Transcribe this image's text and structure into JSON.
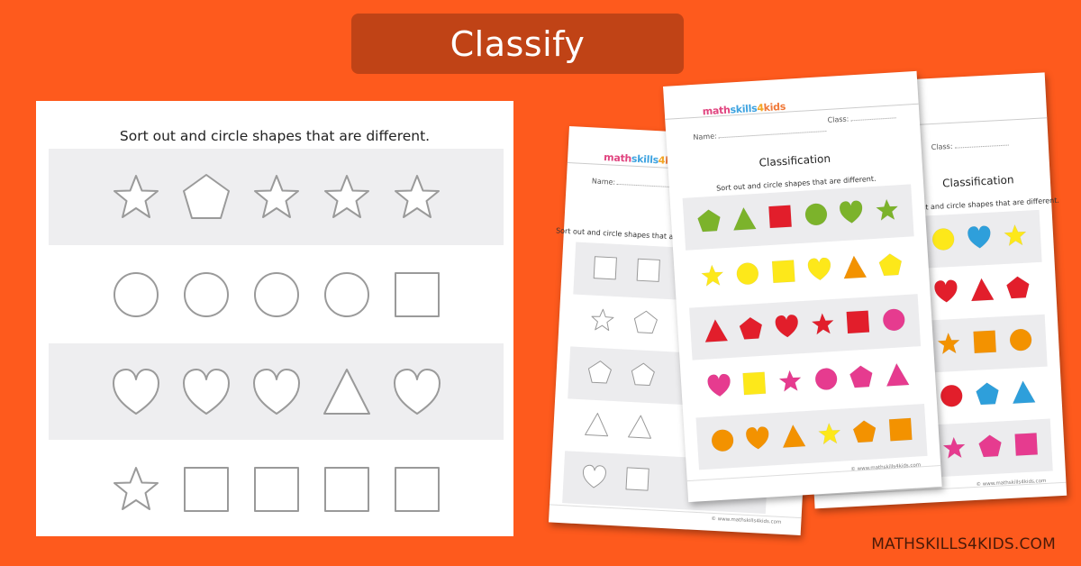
{
  "banner": {
    "title": "Classify",
    "color": "#c04316"
  },
  "background_color": "#fe5a1d",
  "main_sheet": {
    "instruction": "Sort out and circle shapes that are different.",
    "outline_color": "#9a9a9a",
    "rows": [
      {
        "shaded": true,
        "shapes": [
          "star",
          "pentagon",
          "star",
          "star",
          "star"
        ]
      },
      {
        "shaded": false,
        "shapes": [
          "circle",
          "circle",
          "circle",
          "circle",
          "square"
        ]
      },
      {
        "shaded": true,
        "shapes": [
          "heart",
          "heart",
          "heart",
          "triangle",
          "heart"
        ]
      },
      {
        "shaded": false,
        "shapes": [
          "star",
          "square",
          "square",
          "square",
          "square"
        ]
      }
    ]
  },
  "worksheets": {
    "logo": {
      "part1": "math",
      "part2": "skills",
      "part3": "4",
      "part4": "kids"
    },
    "name_label": "Name:",
    "class_label": "Class:",
    "title": "Classification",
    "instruction": "Sort out and circle shapes that are different.",
    "copyright": "© www.mathskills4kids.com",
    "front_rows": [
      {
        "shaded": true,
        "shapes": [
          [
            "pentagon",
            "#7cb32b"
          ],
          [
            "triangle",
            "#7cb32b"
          ],
          [
            "square",
            "#e21e2b"
          ],
          [
            "circle",
            "#7cb32b"
          ],
          [
            "heart",
            "#7cb32b"
          ],
          [
            "star",
            "#7cb32b"
          ]
        ]
      },
      {
        "shaded": false,
        "shapes": [
          [
            "star",
            "#fde81a"
          ],
          [
            "circle",
            "#fde81a"
          ],
          [
            "square",
            "#fde81a"
          ],
          [
            "heart",
            "#fde81a"
          ],
          [
            "triangle",
            "#f39200"
          ],
          [
            "pentagon",
            "#fde81a"
          ]
        ]
      },
      {
        "shaded": true,
        "shapes": [
          [
            "triangle",
            "#e21e2b"
          ],
          [
            "pentagon",
            "#e21e2b"
          ],
          [
            "heart",
            "#e21e2b"
          ],
          [
            "star",
            "#e21e2b"
          ],
          [
            "square",
            "#e21e2b"
          ],
          [
            "circle",
            "#e63b8f"
          ]
        ]
      },
      {
        "shaded": false,
        "shapes": [
          [
            "heart",
            "#e63b8f"
          ],
          [
            "square",
            "#fde81a"
          ],
          [
            "star",
            "#e63b8f"
          ],
          [
            "circle",
            "#e63b8f"
          ],
          [
            "pentagon",
            "#e63b8f"
          ],
          [
            "triangle",
            "#e63b8f"
          ]
        ]
      },
      {
        "shaded": true,
        "shapes": [
          [
            "circle",
            "#f39200"
          ],
          [
            "heart",
            "#f39200"
          ],
          [
            "triangle",
            "#f39200"
          ],
          [
            "star",
            "#fde81a"
          ],
          [
            "pentagon",
            "#f39200"
          ],
          [
            "square",
            "#f39200"
          ]
        ]
      }
    ],
    "right_rows": [
      {
        "shaded": true,
        "shapes": [
          [
            "circle",
            "#fde81a"
          ],
          [
            "heart",
            "#2e9fdb"
          ],
          [
            "star",
            "#fde81a"
          ]
        ]
      },
      {
        "shaded": false,
        "shapes": [
          [
            "heart",
            "#e21e2b"
          ],
          [
            "triangle",
            "#e21e2b"
          ],
          [
            "pentagon",
            "#e21e2b"
          ]
        ]
      },
      {
        "shaded": true,
        "shapes": [
          [
            "star",
            "#f39200"
          ],
          [
            "square",
            "#f39200"
          ],
          [
            "circle",
            "#f39200"
          ]
        ]
      },
      {
        "shaded": false,
        "shapes": [
          [
            "circle",
            "#e21e2b"
          ],
          [
            "pentagon",
            "#2e9fdb"
          ],
          [
            "triangle",
            "#2e9fdb"
          ]
        ]
      },
      {
        "shaded": true,
        "shapes": [
          [
            "star",
            "#e63b8f"
          ],
          [
            "pentagon",
            "#e63b8f"
          ],
          [
            "square",
            "#e63b8f"
          ]
        ]
      }
    ],
    "left_rows": [
      {
        "shaded": true,
        "shapes": [
          "square",
          "square"
        ]
      },
      {
        "shaded": false,
        "shapes": [
          "star",
          "pentagon"
        ]
      },
      {
        "shaded": true,
        "shapes": [
          "pentagon",
          "pentagon"
        ]
      },
      {
        "shaded": false,
        "shapes": [
          "triangle",
          "triangle"
        ]
      },
      {
        "shaded": true,
        "shapes": [
          "heart",
          "square"
        ]
      }
    ]
  },
  "site_brand": "MATHSKILLS4KIDS.COM"
}
